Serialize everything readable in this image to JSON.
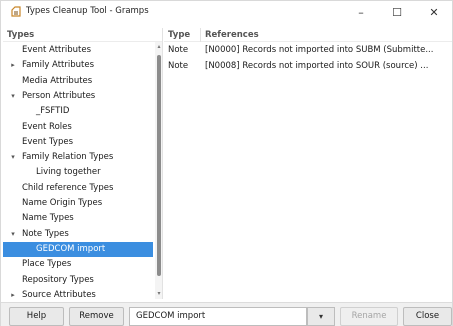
{
  "window": {
    "title": "Types Cleanup Tool - Gramps",
    "minimize": "–",
    "maximize": "☐",
    "close": "✕"
  },
  "tree": {
    "header": "Types",
    "items": [
      {
        "label": "Event Attributes",
        "indent": 1,
        "expander": "",
        "selected": false
      },
      {
        "label": "Family Attributes",
        "indent": 1,
        "expander": "▸",
        "selected": false
      },
      {
        "label": "Media Attributes",
        "indent": 1,
        "expander": "",
        "selected": false
      },
      {
        "label": "Person Attributes",
        "indent": 1,
        "expander": "▾",
        "selected": false
      },
      {
        "label": "_FSFTID",
        "indent": 2,
        "expander": "",
        "selected": false
      },
      {
        "label": "Event Roles",
        "indent": 1,
        "expander": "",
        "selected": false
      },
      {
        "label": "Event Types",
        "indent": 1,
        "expander": "",
        "selected": false
      },
      {
        "label": "Family Relation Types",
        "indent": 1,
        "expander": "▾",
        "selected": false
      },
      {
        "label": "Living together",
        "indent": 2,
        "expander": "",
        "selected": false
      },
      {
        "label": "Child reference Types",
        "indent": 1,
        "expander": "",
        "selected": false
      },
      {
        "label": "Name Origin Types",
        "indent": 1,
        "expander": "",
        "selected": false
      },
      {
        "label": "Name Types",
        "indent": 1,
        "expander": "",
        "selected": false
      },
      {
        "label": "Note Types",
        "indent": 1,
        "expander": "▾",
        "selected": false
      },
      {
        "label": "GEDCOM import",
        "indent": 2,
        "expander": "",
        "selected": true
      },
      {
        "label": "Place Types",
        "indent": 1,
        "expander": "",
        "selected": false
      },
      {
        "label": "Repository Types",
        "indent": 1,
        "expander": "",
        "selected": false
      },
      {
        "label": "Source Attributes",
        "indent": 1,
        "expander": "▸",
        "selected": false
      }
    ]
  },
  "list": {
    "headers": {
      "type": "Type",
      "references": "References"
    },
    "rows": [
      {
        "type": "Note",
        "reference": "[N0000] Records not imported into SUBM (Submitte..."
      },
      {
        "type": "Note",
        "reference": "[N0008] Records not imported into SOUR (source) ..."
      }
    ]
  },
  "bottom": {
    "help": "Help",
    "remove": "Remove",
    "name_value": "GEDCOM import",
    "combo_arrow": "▾",
    "rename": "Rename",
    "close": "Close"
  },
  "colors": {
    "selection": "#3b8ee0",
    "app_icon": "#c8862a"
  }
}
